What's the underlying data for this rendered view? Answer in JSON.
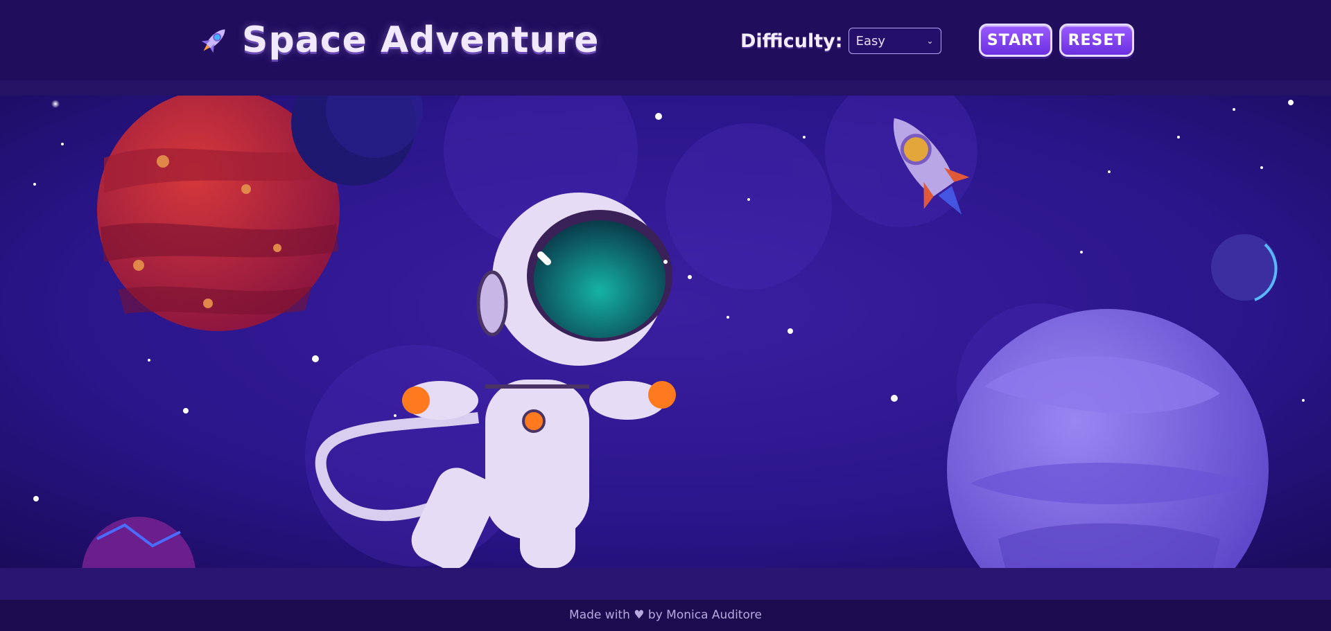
{
  "header": {
    "title": "Space Adventure",
    "logo_icon": "rocket-icon"
  },
  "controls": {
    "difficulty_label": "Difficulty:",
    "difficulty_selected": "Easy",
    "start_label": "START",
    "reset_label": "RESET"
  },
  "footer": {
    "text": "Made with ♥ by Monica Auditore"
  },
  "colors": {
    "background": "#1d0c55",
    "button": "#7b3ff2",
    "title": "#f1e9ff",
    "red_planet": "#b3213f",
    "purple_planet": "#7c63e0"
  }
}
